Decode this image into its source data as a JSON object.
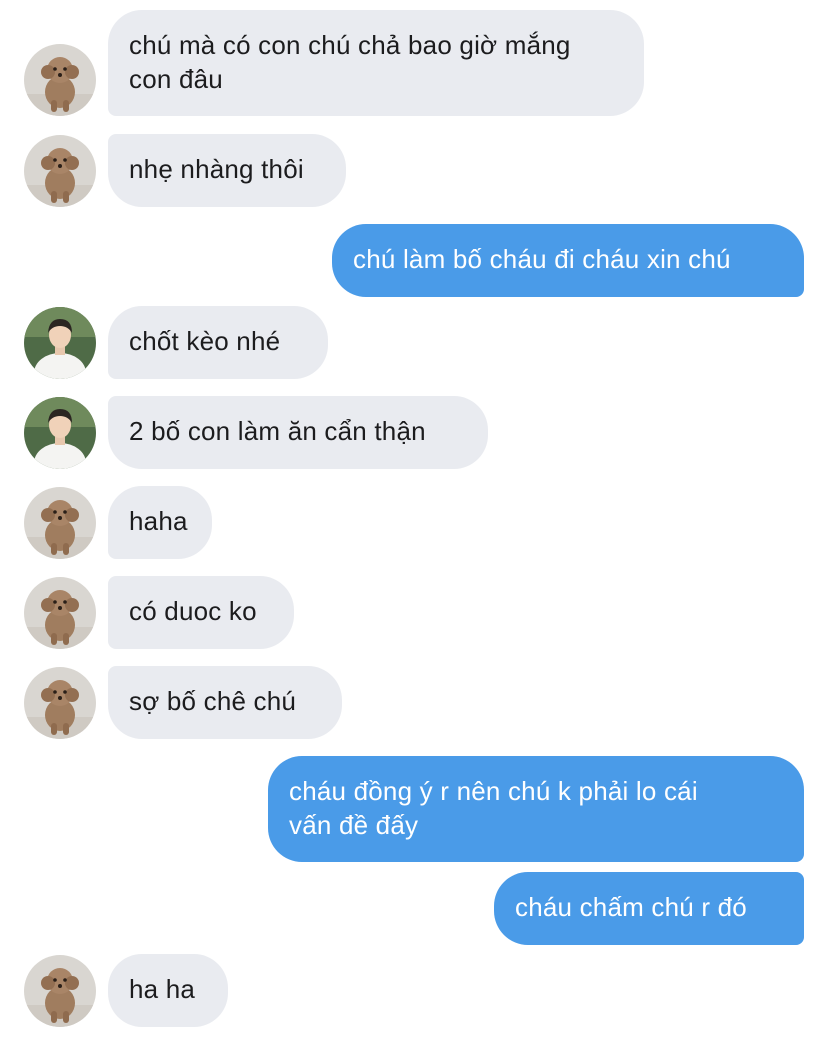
{
  "avatars": {
    "poodle": "poodle-avatar-icon",
    "person": "person-avatar-icon"
  },
  "colors": {
    "incoming_bubble": "#e9ebf0",
    "outgoing_bubble": "#4a9be8"
  },
  "messages": [
    {
      "from": "other-poodle",
      "text": "chú mà có con chú chả bao giờ mắng\ncon đâu"
    },
    {
      "from": "other-poodle",
      "text": "nhẹ nhàng thôi"
    },
    {
      "from": "me",
      "text": "chú làm bố cháu đi cháu xin chú"
    },
    {
      "from": "other-person",
      "text": "chốt kèo nhé"
    },
    {
      "from": "other-person",
      "text": "2 bố con làm ăn cẩn thận"
    },
    {
      "from": "other-poodle",
      "text": "haha"
    },
    {
      "from": "other-poodle",
      "text": "có duoc ko"
    },
    {
      "from": "other-poodle",
      "text": "sợ bố chê chú"
    },
    {
      "from": "me",
      "text": "cháu đồng ý r nên chú k phải lo cái\nvấn đề đấy"
    },
    {
      "from": "me",
      "text": "cháu chấm chú r đó"
    },
    {
      "from": "other-poodle",
      "text": "ha ha"
    }
  ]
}
